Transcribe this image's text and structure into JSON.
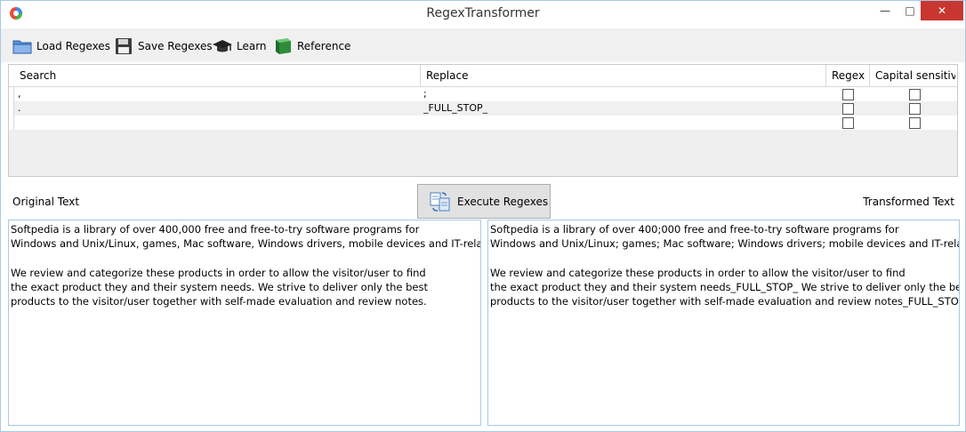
{
  "window": {
    "title": "RegexTransformer",
    "controls": {
      "minimize": "—",
      "maximize": "□",
      "close": "✕"
    }
  },
  "toolbar": {
    "load_label": "Load Regexes",
    "save_label": "Save Regexes",
    "learn_label": "Learn",
    "reference_label": "Reference"
  },
  "grid": {
    "columns": [
      "Search",
      "Replace",
      "Regex",
      "Capital sensitive"
    ],
    "rows": [
      {
        "search": ",",
        "replace": ";",
        "regex": false,
        "capital_sensitive": false
      },
      {
        "search": ".",
        "replace": "_FULL_STOP_",
        "regex": false,
        "capital_sensitive": false
      },
      {
        "search": "",
        "replace": "",
        "regex": false,
        "capital_sensitive": false
      }
    ]
  },
  "middle": {
    "original_label": "Original Text",
    "execute_label": "Execute Regexes",
    "transformed_label": "Transformed Text"
  },
  "original_text": "Softpedia is a library of over 400,000 free and free-to-try software programs for\nWindows and Unix/Linux, games, Mac software, Windows drivers, mobile devices and IT-related artic\n\nWe review and categorize these products in order to allow the visitor/user to find\nthe exact product they and their system needs. We strive to deliver only the best\nproducts to the visitor/user together with self-made evaluation and review notes.",
  "transformed_text": "Softpedia is a library of over 400;000 free and free-to-try software programs for\nWindows and Unix/Linux; games; Mac software; Windows drivers; mobile devices and IT-related artic\n\nWe review and categorize these products in order to allow the visitor/user to find\nthe exact product they and their system needs_FULL_STOP_ We strive to deliver only the best\nproducts to the visitor/user together with self-made evaluation and review notes_FULL_STOP_",
  "icons": {
    "app": "regex-app-icon",
    "load": "folder-icon",
    "save": "floppy-disk-icon",
    "learn": "graduation-cap-icon",
    "reference": "book-icon",
    "execute": "transform-icon"
  },
  "colors": {
    "accent_border": "#a9c8e6",
    "close_button": "#c7372f",
    "reference_book": "#2e8b3a"
  }
}
